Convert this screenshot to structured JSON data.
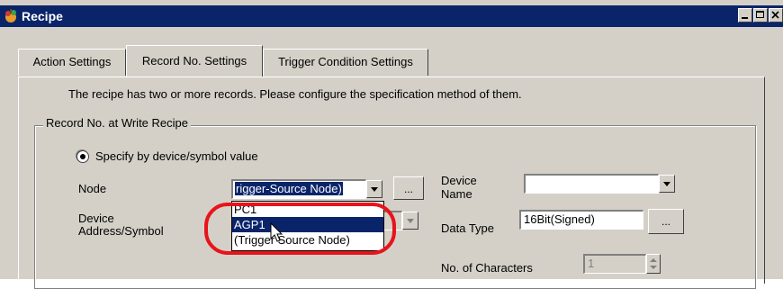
{
  "window": {
    "title": "Recipe"
  },
  "tabs": [
    {
      "label": "Action Settings"
    },
    {
      "label": "Record No. Settings"
    },
    {
      "label": "Trigger Condition Settings"
    }
  ],
  "info_text": "The recipe has two or more records. Please configure the specification method of them.",
  "group": {
    "label": "Record No. at Write Recipe",
    "radio_label": "Specify by device/symbol value",
    "node_label": "Node",
    "node_value": "rigger-Source Node)",
    "browse_label": "...",
    "device_address_label_line1": "Device",
    "device_address_label_line2": "Address/Symbol",
    "dropdown_options": [
      "PC1",
      "AGP1",
      "(Trigger Source Node)"
    ],
    "dropdown_highlighted": "AGP1",
    "device_name_label_line1": "Device",
    "device_name_label_line2": "Name",
    "device_name_value": "",
    "data_type_label": "Data Type",
    "data_type_value": "16Bit(Signed)",
    "characters_label": "No. of Characters",
    "characters_value": "1"
  },
  "colors": {
    "titlebar": "#0a246a",
    "face": "#d4d0c8",
    "highlight": "#0a246a",
    "callout": "#e8141b"
  }
}
